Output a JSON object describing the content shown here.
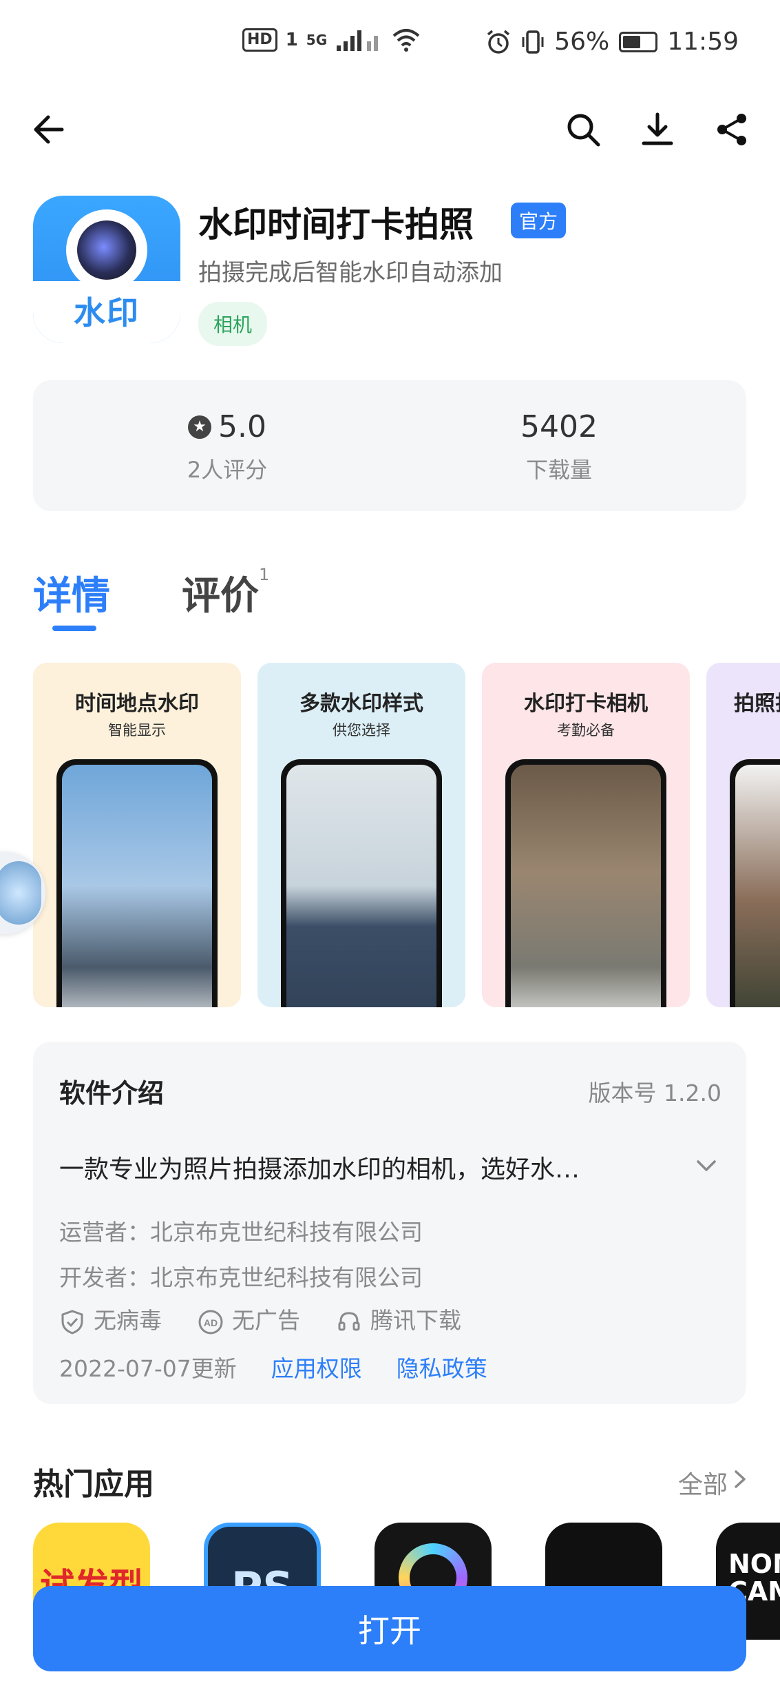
{
  "status_bar": {
    "network_badge": "HD",
    "network_sim": "1",
    "signal": "5G",
    "battery_text": "56%",
    "battery_level": 0.56,
    "time": "11:59"
  },
  "toolbar": {
    "back": "back-icon",
    "search": "search-icon",
    "download": "download-icon",
    "share": "share-icon"
  },
  "app": {
    "icon_text": "水印",
    "name": "水印时间打卡拍照",
    "official_badge": "官方",
    "subtitle": "拍摄完成后智能水印自动添加",
    "category": "相机"
  },
  "stats": {
    "rating": "5.0",
    "rating_label": "2人评分",
    "downloads": "5402",
    "downloads_label": "下载量"
  },
  "tabs": [
    {
      "label": "详情",
      "active": true
    },
    {
      "label": "评价",
      "count": "1",
      "active": false
    }
  ],
  "screenshots": [
    {
      "title": "时间地点水印",
      "subtitle": "智能显示",
      "bg": "#fdf1dc"
    },
    {
      "title": "多款水印样式",
      "subtitle": "供您选择",
      "bg": "#dceff7"
    },
    {
      "title": "水印打卡相机",
      "subtitle": "考勤必备",
      "bg": "#fde5e8"
    },
    {
      "title": "拍照打",
      "subtitle": "",
      "bg": "#ece4fb"
    }
  ],
  "intro": {
    "title": "软件介绍",
    "version": "版本号 1.2.0",
    "description": "一款专业为照片拍摄添加水印的相机，选好水…",
    "operator": "运营者：北京布克世纪科技有限公司",
    "developer": "开发者：北京布克世纪科技有限公司",
    "badges": [
      "无病毒",
      "无广告",
      "腾讯下载"
    ],
    "updated": "2022-07-07更新",
    "permissions_link": "应用权限",
    "privacy_link": "隐私政策"
  },
  "hot_apps": {
    "title": "热门应用",
    "all_label": "全部",
    "apps": [
      {
        "label": "试发型",
        "bg": "#ffd93a",
        "color": "#e0282b"
      },
      {
        "label": "PS",
        "bg": "#1a2f4a",
        "color": "#cfe6ff"
      },
      {
        "label": "",
        "bg": "#151515",
        "color": "#ffffff"
      },
      {
        "label": "",
        "bg": "#101010",
        "color": "#ffffff"
      },
      {
        "label": "NOM CAM",
        "bg": "#121212",
        "color": "#ffffff"
      }
    ]
  },
  "open_button": "打开"
}
